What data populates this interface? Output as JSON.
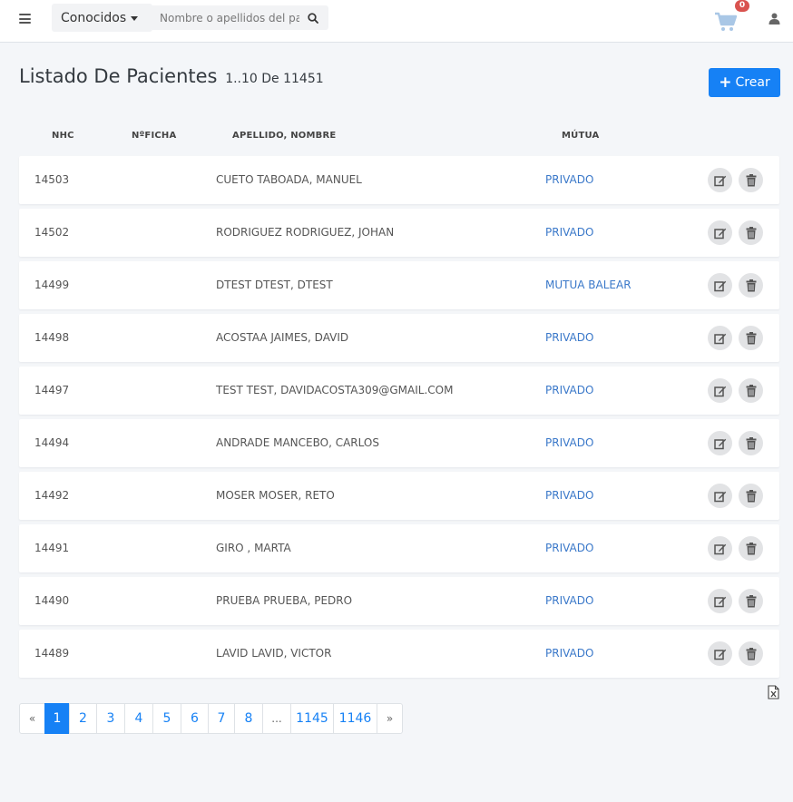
{
  "topbar": {
    "filter_label": "Conocidos",
    "search_placeholder": "Nombre o apellidos del paciente",
    "cart_count": "0"
  },
  "header": {
    "title": "Listado De Pacientes",
    "count": "1..10 De 11451",
    "create_label": "Crear"
  },
  "table": {
    "columns": [
      "NHC",
      "NºFICHA",
      "APELLIDO, NOMBRE",
      "MÚTUA"
    ],
    "rows": [
      {
        "nhc": "14503",
        "ficha": "",
        "nombre": "CUETO TABOADA, MANUEL",
        "mutua": "PRIVADO"
      },
      {
        "nhc": "14502",
        "ficha": "",
        "nombre": "RODRIGUEZ RODRIGUEZ, JOHAN",
        "mutua": "PRIVADO"
      },
      {
        "nhc": "14499",
        "ficha": "",
        "nombre": "DTEST DTEST, DTEST",
        "mutua": "MUTUA BALEAR"
      },
      {
        "nhc": "14498",
        "ficha": "",
        "nombre": "ACOSTAA JAIMES, DAVID",
        "mutua": "PRIVADO"
      },
      {
        "nhc": "14497",
        "ficha": "",
        "nombre": "TEST TEST, DAVIDACOSTA309@GMAIL.COM",
        "mutua": "PRIVADO"
      },
      {
        "nhc": "14494",
        "ficha": "",
        "nombre": "ANDRADE MANCEBO, CARLOS",
        "mutua": "PRIVADO"
      },
      {
        "nhc": "14492",
        "ficha": "",
        "nombre": "MOSER MOSER, RETO",
        "mutua": "PRIVADO"
      },
      {
        "nhc": "14491",
        "ficha": "",
        "nombre": "GIRO , MARTA",
        "mutua": "PRIVADO"
      },
      {
        "nhc": "14490",
        "ficha": "",
        "nombre": "PRUEBA PRUEBA, PEDRO",
        "mutua": "PRIVADO"
      },
      {
        "nhc": "14489",
        "ficha": "",
        "nombre": "LAVID LAVID, VICTOR",
        "mutua": "PRIVADO"
      }
    ]
  },
  "pagination": {
    "prev": "«",
    "pages": [
      "1",
      "2",
      "3",
      "4",
      "5",
      "6",
      "7",
      "8",
      "...",
      "1145",
      "1146"
    ],
    "next": "»",
    "active": "1"
  },
  "icons": {
    "menu": "hamburger-icon",
    "search": "search-icon",
    "cart": "shopping-cart-icon",
    "user": "user-icon",
    "edit": "edit-icon",
    "delete": "trash-icon",
    "export": "excel-file-icon"
  },
  "colors": {
    "primary": "#1681f5",
    "link": "#3a78c9",
    "badge": "#d9534f",
    "background": "#f4f6f9"
  }
}
